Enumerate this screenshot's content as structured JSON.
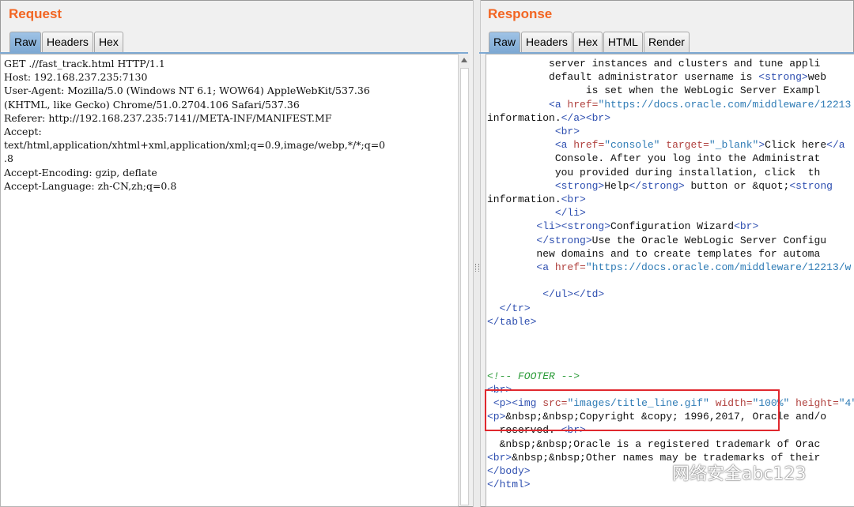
{
  "request": {
    "title": "Request",
    "tabs": [
      "Raw",
      "Headers",
      "Hex"
    ],
    "active_tab": "Raw",
    "lines": [
      "GET .//fast_track.html HTTP/1.1",
      "Host: 192.168.237.235:7130",
      "User-Agent: Mozilla/5.0 (Windows NT 6.1; WOW64) AppleWebKit/537.36",
      "(KHTML, like Gecko) Chrome/51.0.2704.106 Safari/537.36",
      "Referer: http://192.168.237.235:7141//META-INF/MANIFEST.MF",
      "Accept:",
      "text/html,application/xhtml+xml,application/xml;q=0.9,image/webp,*/*;q=0",
      ".8",
      "Accept-Encoding: gzip, deflate",
      "Accept-Language: zh-CN,zh;q=0.8"
    ]
  },
  "response": {
    "title": "Response",
    "tabs": [
      "Raw",
      "Headers",
      "Hex",
      "HTML",
      "Render"
    ],
    "active_tab": "Raw",
    "lines": [
      [
        [
          "t",
          "          server instances and clusters and tune appli"
        ]
      ],
      [
        [
          "t",
          "          default administrator username is "
        ],
        [
          "g",
          "<strong>"
        ],
        [
          "t",
          "web"
        ]
      ],
      [
        [
          "t",
          "                is set when the WebLogic Server Exampl"
        ]
      ],
      [
        [
          "t",
          "          "
        ],
        [
          "g",
          "<a "
        ],
        [
          "a",
          "href="
        ],
        [
          "s",
          "\"https://docs.oracle.com/middleware/12213"
        ]
      ],
      [
        [
          "t",
          "information."
        ],
        [
          "g",
          "</a><br>"
        ]
      ],
      [
        [
          "t",
          "           "
        ],
        [
          "g",
          "<br>"
        ]
      ],
      [
        [
          "t",
          "           "
        ],
        [
          "g",
          "<a "
        ],
        [
          "a",
          "href="
        ],
        [
          "s",
          "\"console\""
        ],
        [
          "g",
          " "
        ],
        [
          "a",
          "target="
        ],
        [
          "s",
          "\"_blank\""
        ],
        [
          "g",
          ">"
        ],
        [
          "t",
          "Click here"
        ],
        [
          "g",
          "</a"
        ]
      ],
      [
        [
          "t",
          "           Console. After you log into the Administrat"
        ]
      ],
      [
        [
          "t",
          "           you provided during installation, click  th"
        ]
      ],
      [
        [
          "t",
          "           "
        ],
        [
          "g",
          "<strong>"
        ],
        [
          "t",
          "Help"
        ],
        [
          "g",
          "</strong>"
        ],
        [
          "t",
          " button or &quot;"
        ],
        [
          "g",
          "<strong"
        ]
      ],
      [
        [
          "t",
          "information."
        ],
        [
          "g",
          "<br>"
        ]
      ],
      [
        [
          "t",
          "           "
        ],
        [
          "g",
          "</li>"
        ]
      ],
      [
        [
          "t",
          "        "
        ],
        [
          "g",
          "<li><strong>"
        ],
        [
          "t",
          "Configuration Wizard"
        ],
        [
          "g",
          "<br>"
        ]
      ],
      [
        [
          "t",
          "        "
        ],
        [
          "g",
          "</strong>"
        ],
        [
          "t",
          "Use the Oracle WebLogic Server Configu"
        ]
      ],
      [
        [
          "t",
          "        new domains and to create templates for automa"
        ]
      ],
      [
        [
          "t",
          "        "
        ],
        [
          "g",
          "<a "
        ],
        [
          "a",
          "href="
        ],
        [
          "s",
          "\"https://docs.oracle.com/middleware/12213/w"
        ]
      ],
      [
        [
          "t",
          ""
        ]
      ],
      [
        [
          "t",
          "         "
        ],
        [
          "g",
          "</ul></td>"
        ]
      ],
      [
        [
          "t",
          "  "
        ],
        [
          "g",
          "</tr>"
        ]
      ],
      [
        [
          "g",
          "</table>"
        ]
      ],
      [
        [
          "t",
          ""
        ]
      ],
      [
        [
          "t",
          ""
        ]
      ],
      [
        [
          "t",
          ""
        ]
      ],
      [
        [
          "c",
          "<!-- FOOTER -->"
        ]
      ],
      [
        [
          "g",
          "<br>"
        ]
      ],
      [
        [
          "t",
          " "
        ],
        [
          "g",
          "<p><img "
        ],
        [
          "a",
          "src="
        ],
        [
          "s",
          "\"images/title_line.gif\""
        ],
        [
          "t",
          " "
        ],
        [
          "a",
          "width="
        ],
        [
          "s",
          "\"100%\""
        ],
        [
          "t",
          " "
        ],
        [
          "a",
          "height="
        ],
        [
          "s",
          "\"4\""
        ]
      ],
      [
        [
          "g",
          "<p>"
        ],
        [
          "t",
          "&nbsp;&nbsp;Copyright &copy; 1996,2017, Oracle and/o"
        ]
      ],
      [
        [
          "t",
          "  reserved. "
        ],
        [
          "g",
          "<br>"
        ]
      ],
      [
        [
          "t",
          "  &nbsp;&nbsp;Oracle is a registered trademark of Orac"
        ]
      ],
      [
        [
          "g",
          "<br>"
        ],
        [
          "t",
          "&nbsp;&nbsp;Other names may be trademarks of their"
        ]
      ],
      [
        [
          "g",
          "</body>"
        ]
      ],
      [
        [
          "g",
          "</html>"
        ]
      ]
    ]
  },
  "watermark": "网络安全abc123",
  "colors": {
    "title": "#f26522",
    "tag": "#2e4fb0",
    "attr": "#b0413e",
    "string": "#2e7bb5",
    "comment": "#2d9c3a",
    "highlight": "#e0282e"
  }
}
